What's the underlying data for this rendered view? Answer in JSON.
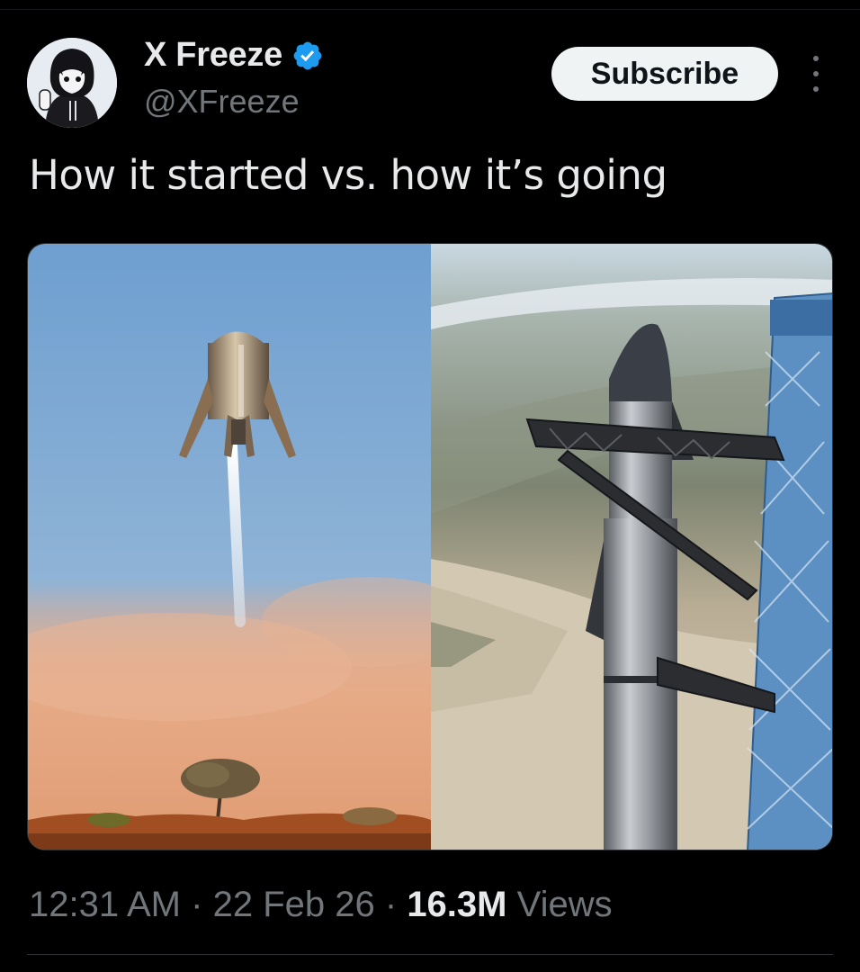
{
  "tweet": {
    "display_name": "X Freeze",
    "handle": "@XFreeze",
    "verified": true,
    "subscribe_label": "Subscribe",
    "text": "How it started vs. how it’s going",
    "time": "12:31 AM",
    "date": "22 Feb 26",
    "separator": "·",
    "views_count": "16.3M",
    "views_label": "Views"
  },
  "colors": {
    "background": "#000000",
    "primary_text": "#e7e9ea",
    "secondary_text": "#71767b",
    "verified_badge": "#1d9bf0",
    "subscribe_bg": "#eff3f4"
  },
  "icons": {
    "verified": "verified-badge-icon",
    "more": "more-options-icon"
  }
}
